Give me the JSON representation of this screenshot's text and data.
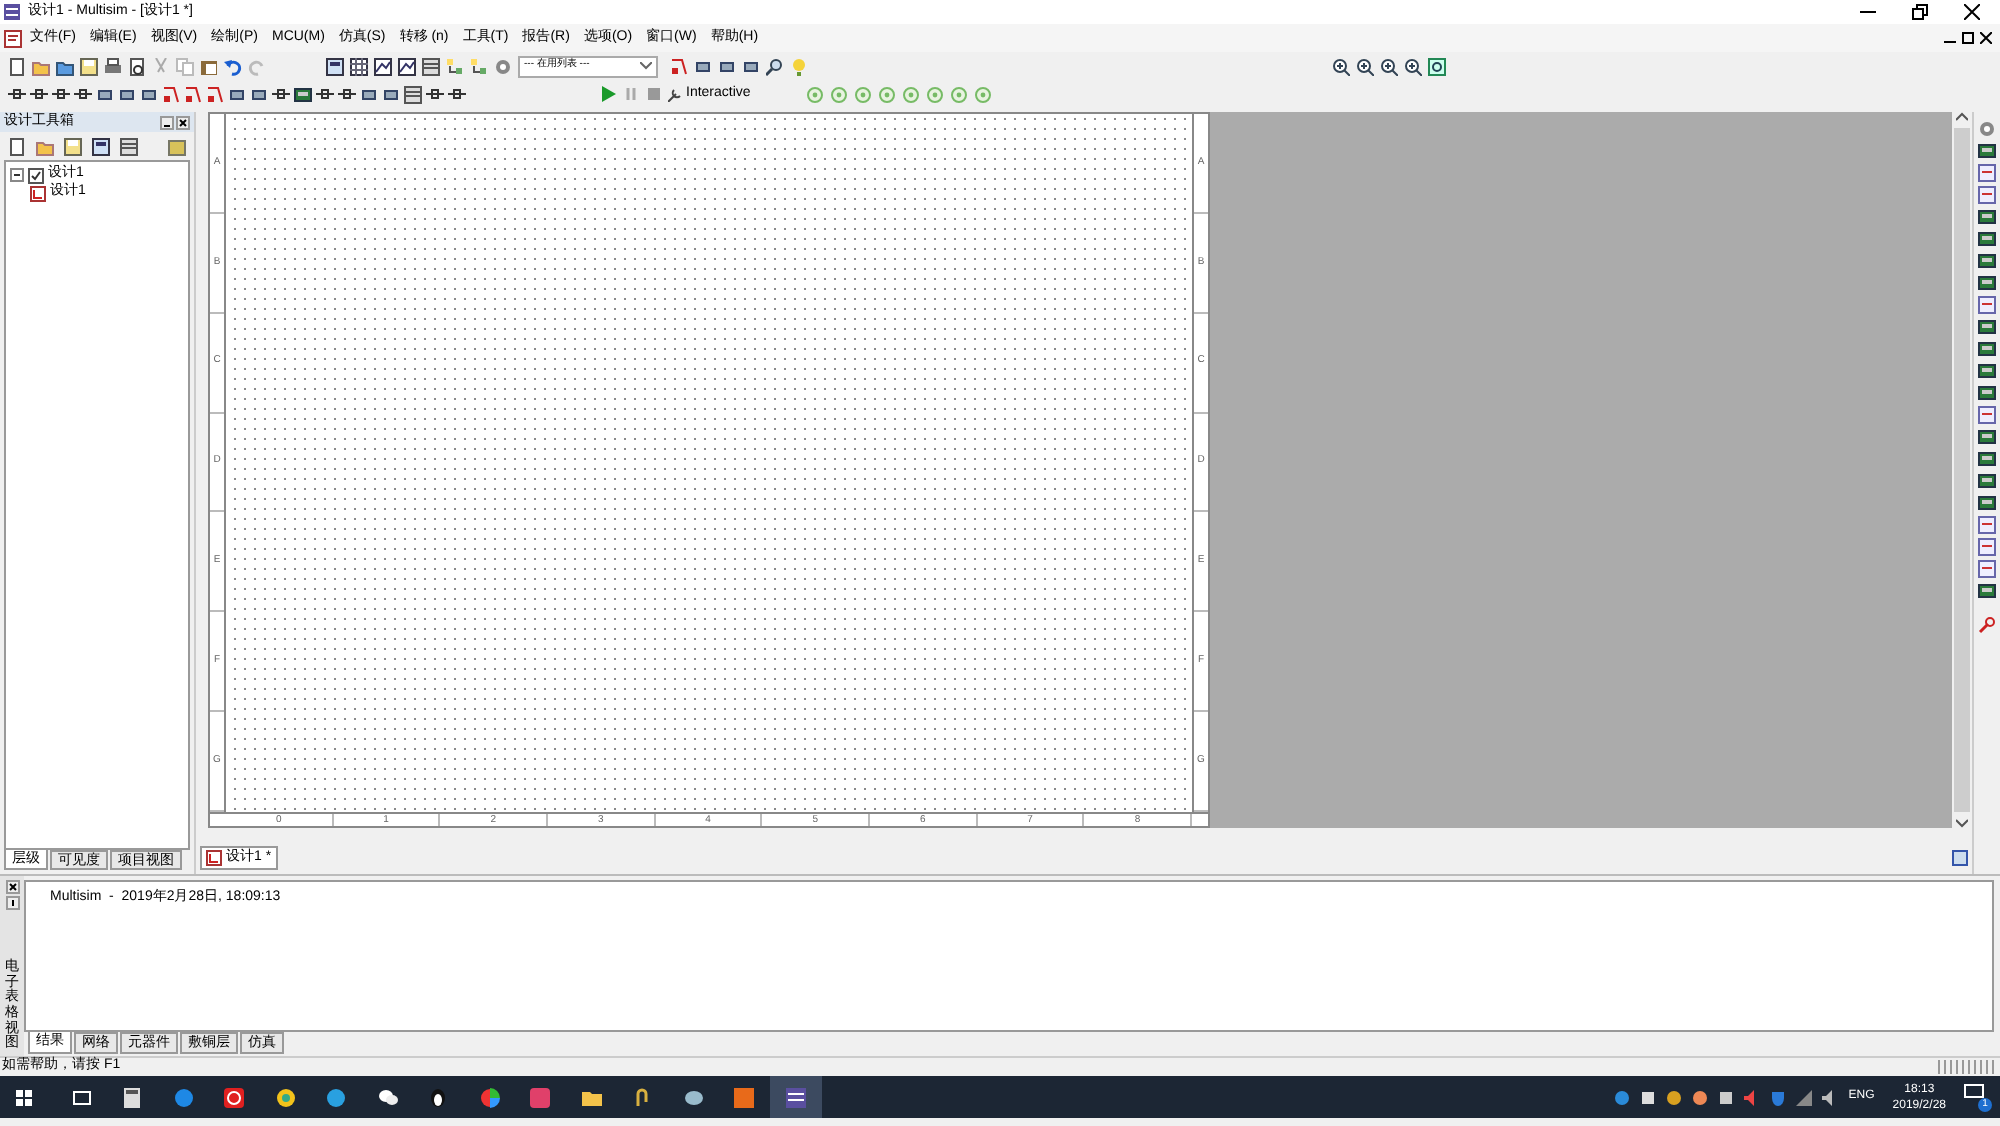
{
  "window": {
    "title": "设计1 - Multisim - [设计1 *]"
  },
  "menu": [
    {
      "label": "文件(F)"
    },
    {
      "label": "编辑(E)"
    },
    {
      "label": "视图(V)"
    },
    {
      "label": "绘制(P)"
    },
    {
      "label": "MCU(M)"
    },
    {
      "label": "仿真(S)"
    },
    {
      "label": "转移 (n)"
    },
    {
      "label": "工具(T)"
    },
    {
      "label": "报告(R)"
    },
    {
      "label": "选项(O)"
    },
    {
      "label": "窗口(W)"
    },
    {
      "label": "帮助(H)"
    }
  ],
  "toolbar": {
    "in_use_list": "--- 在用列表 ---",
    "run_mode": "Interactive"
  },
  "design_toolbox": {
    "title": "设计工具箱",
    "tree": [
      {
        "label": "设计1",
        "expanded": true,
        "children": [
          {
            "label": "设计1"
          }
        ]
      }
    ],
    "tabs": [
      {
        "label": "层级",
        "selected": true
      },
      {
        "label": "可见度",
        "selected": false
      },
      {
        "label": "项目视图",
        "selected": false
      }
    ]
  },
  "sheet": {
    "left_row_labels": [
      "A",
      "B",
      "C",
      "D",
      "E",
      "F",
      "G"
    ],
    "right_row_labels": [
      "A",
      "B",
      "C",
      "D",
      "E",
      "F",
      "G"
    ],
    "column_labels": [
      "0",
      "1",
      "2",
      "3",
      "4",
      "5",
      "6",
      "7",
      "8"
    ]
  },
  "document_tabs": [
    {
      "label": "设计1 *",
      "selected": true
    }
  ],
  "output": {
    "side_label": "电子表格视图",
    "lines": [
      "Multisim  -  2019年2月28日, 18:09:13"
    ],
    "tabs": [
      {
        "label": "结果",
        "selected": true
      },
      {
        "label": "网络",
        "selected": false
      },
      {
        "label": "元器件",
        "selected": false
      },
      {
        "label": "敷铜层",
        "selected": false
      },
      {
        "label": "仿真",
        "selected": false
      }
    ]
  },
  "status_bar": {
    "text": "如需帮助，请按 F1"
  },
  "taskbar": {
    "language": "ENG",
    "time": "18:13",
    "date": "2019/2/28",
    "notification_count": "1"
  }
}
